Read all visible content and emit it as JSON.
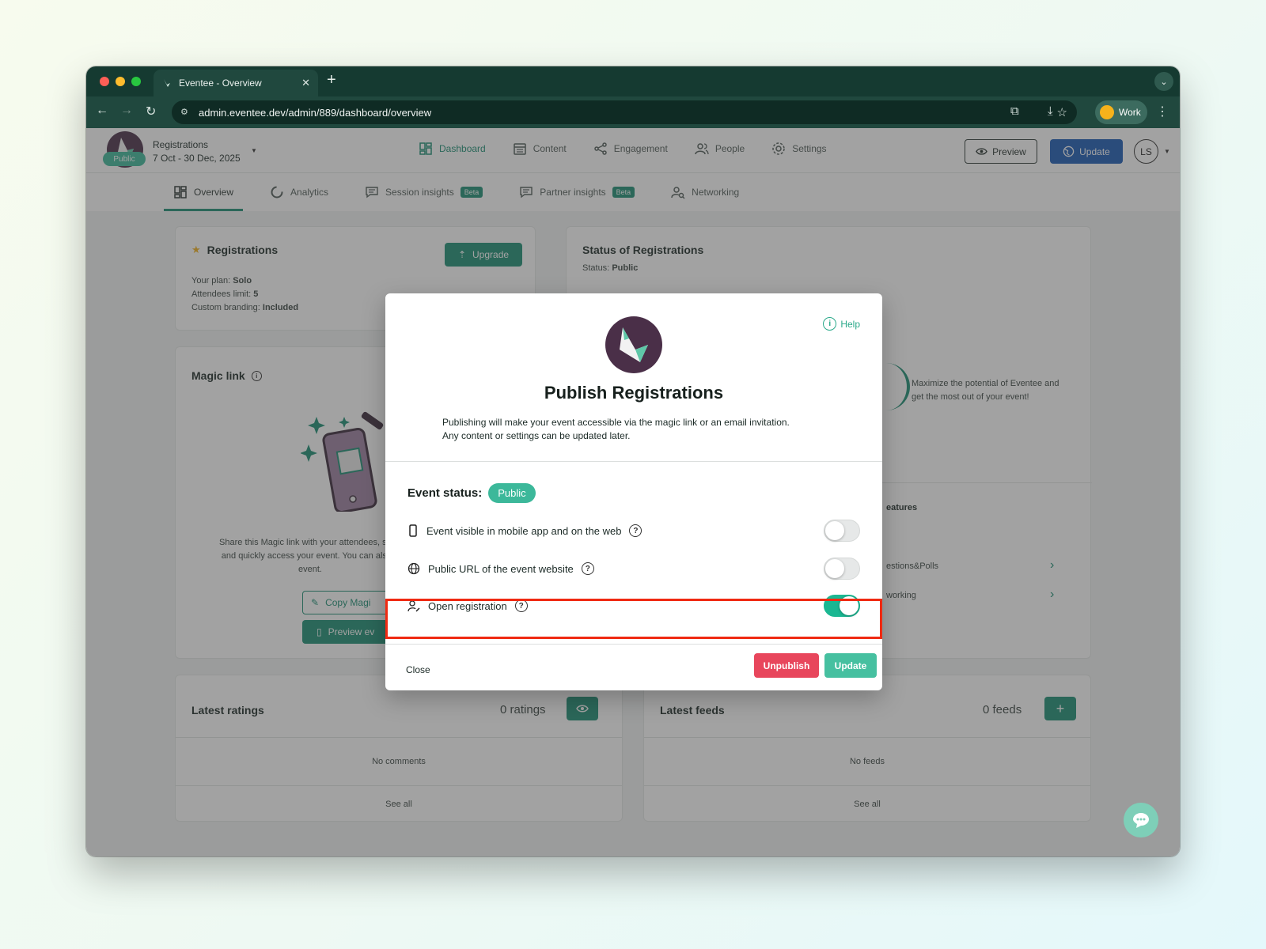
{
  "browser": {
    "tab_title": "Eventee - Overview",
    "url": "admin.eventee.dev/admin/889/dashboard/overview",
    "profile_label": "Work"
  },
  "event": {
    "name": "Registrations",
    "dates": "7 Oct - 30 Dec, 2025",
    "status_badge": "Public"
  },
  "main_nav": [
    {
      "label": "Dashboard",
      "icon": "dashboard-icon",
      "active": true
    },
    {
      "label": "Content",
      "icon": "calendar-icon"
    },
    {
      "label": "Engagement",
      "icon": "share-icon"
    },
    {
      "label": "People",
      "icon": "people-icon"
    },
    {
      "label": "Settings",
      "icon": "gear-icon"
    }
  ],
  "header_actions": {
    "preview": "Preview",
    "update": "Update",
    "avatar_initials": "LS"
  },
  "sub_nav": [
    {
      "label": "Overview",
      "icon": "overview-icon",
      "active": true
    },
    {
      "label": "Analytics",
      "icon": "analytics-icon"
    },
    {
      "label": "Session insights",
      "icon": "comment-icon",
      "badge": "Beta"
    },
    {
      "label": "Partner insights",
      "icon": "comment-icon",
      "badge": "Beta"
    },
    {
      "label": "Networking",
      "icon": "networking-icon"
    }
  ],
  "registrations_card": {
    "title": "Registrations",
    "upgrade_label": "Upgrade",
    "plan_label": "Your plan:",
    "plan_value": "Solo",
    "limit_label": "Attendees limit:",
    "limit_value": "5",
    "branding_label": "Custom branding:",
    "branding_value": "Included"
  },
  "status_card": {
    "title": "Status of Registrations",
    "status_label": "Status:",
    "status_value": "Public"
  },
  "magic_link_card": {
    "title": "Magic link",
    "desc_1": "Share this Magic link with your attendees, so th",
    "desc_2": "and quickly access your event. You can also u",
    "desc_3": "event.",
    "copy_label": "Copy Magi",
    "preview_label": "Preview ev"
  },
  "features_card": {
    "promo_1": "Maximize the potential of Eventee and",
    "promo_2": "get the most out of your event!",
    "heading_partial": "eatures",
    "item_1": "estions&Polls",
    "item_2": "working"
  },
  "ratings_card": {
    "title": "Latest ratings",
    "count": "0 ratings",
    "empty": "No comments",
    "see_all": "See all"
  },
  "feeds_card": {
    "title": "Latest feeds",
    "count": "0 feeds",
    "empty": "No feeds",
    "see_all": "See all"
  },
  "modal": {
    "help": "Help",
    "title": "Publish Registrations",
    "desc_line1": "Publishing will make your event accessible via the magic link or an email invitation.",
    "desc_line2": "Any content or settings can be updated later.",
    "status_label": "Event status:",
    "status_value": "Public",
    "options": [
      {
        "label": "Event visible in mobile app and on the web",
        "icon": "mobile-icon",
        "enabled": false
      },
      {
        "label": "Public URL of the event website",
        "icon": "globe-icon",
        "enabled": false
      },
      {
        "label": "Open registration",
        "icon": "user-edit-icon",
        "enabled": true
      }
    ],
    "close": "Close",
    "unpublish": "Unpublish",
    "update": "Update"
  },
  "colors": {
    "accent": "#1c8f74",
    "danger": "#e8465c",
    "highlight": "#f02a12",
    "brand_primary": "#1a5ab5"
  }
}
